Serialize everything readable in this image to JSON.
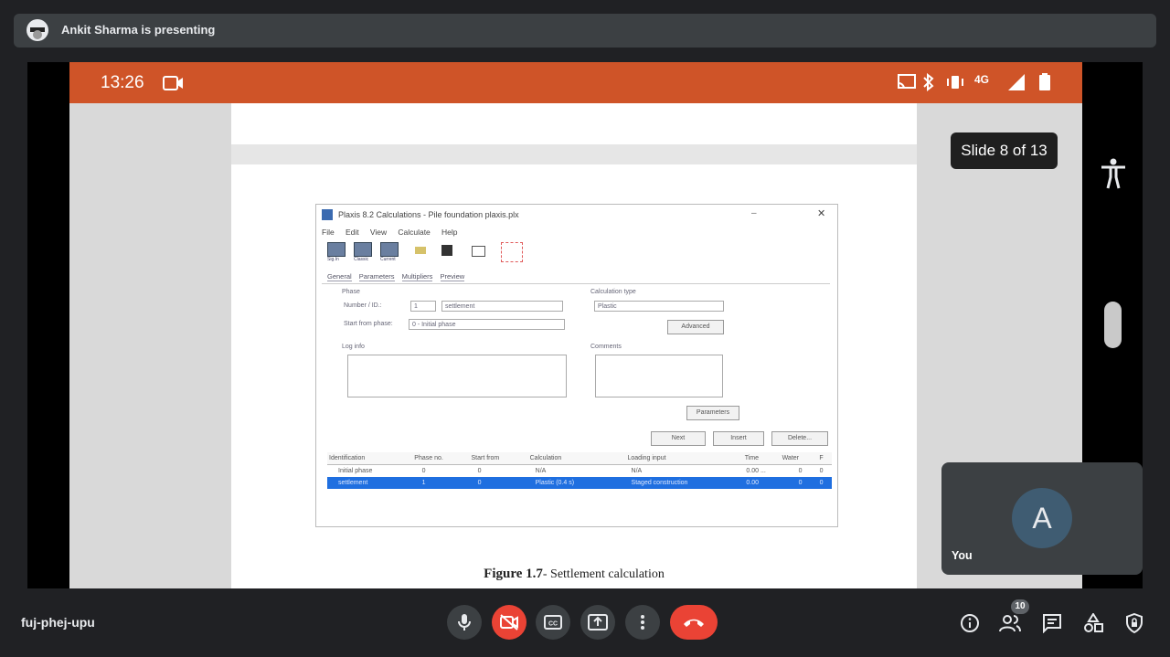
{
  "presenter": {
    "text": "Ankit Sharma is presenting"
  },
  "device_status": {
    "time": "13:26",
    "network": "4G"
  },
  "slide_indicator": "Slide 8 of 13",
  "embedded_app": {
    "window_title": "Plaxis 8.2 Calculations - Pile foundation plaxis.plx",
    "menu": [
      "File",
      "Edit",
      "View",
      "Calculate",
      "Help"
    ],
    "toolbar_labels": [
      "Sig.In",
      "Classic",
      "Current"
    ],
    "tabs": [
      "General",
      "Parameters",
      "Multipliers",
      "Preview"
    ],
    "phase_group": "Phase",
    "number_label": "Number / ID.:",
    "number_value": "1",
    "id_value": "settlement",
    "start_from_label": "Start from phase:",
    "start_from_value": "0 - Initial phase",
    "calc_type_group": "Calculation type",
    "calc_type_value": "Plastic",
    "advanced_button": "Advanced",
    "log_info_label": "Log info",
    "comments_label": "Comments",
    "parameters_button": "Parameters",
    "next_button": "Next",
    "insert_button": "Insert",
    "delete_button": "Delete...",
    "table": {
      "headers": [
        "Identification",
        "Phase no.",
        "Start from",
        "Calculation",
        "Loading input",
        "Time",
        "Water",
        "F"
      ],
      "rows": [
        [
          "Initial phase",
          "0",
          "0",
          "N/A",
          "N/A",
          "0.00 ...",
          "0",
          "0"
        ],
        [
          "settlement",
          "1",
          "0",
          "Plastic (0.4 s)",
          "Staged construction",
          "0.00",
          "0",
          "0"
        ]
      ]
    },
    "caption_label": "Figure 1.7",
    "caption_text": "- Settlement calculation"
  },
  "self_tile": {
    "avatar_letter": "A",
    "name": "You"
  },
  "meeting": {
    "code": "fuj-phej-upu",
    "participants": "10"
  },
  "colors": {
    "status_bar": "#cf5428",
    "end_call": "#ea4335",
    "background": "#202124"
  }
}
